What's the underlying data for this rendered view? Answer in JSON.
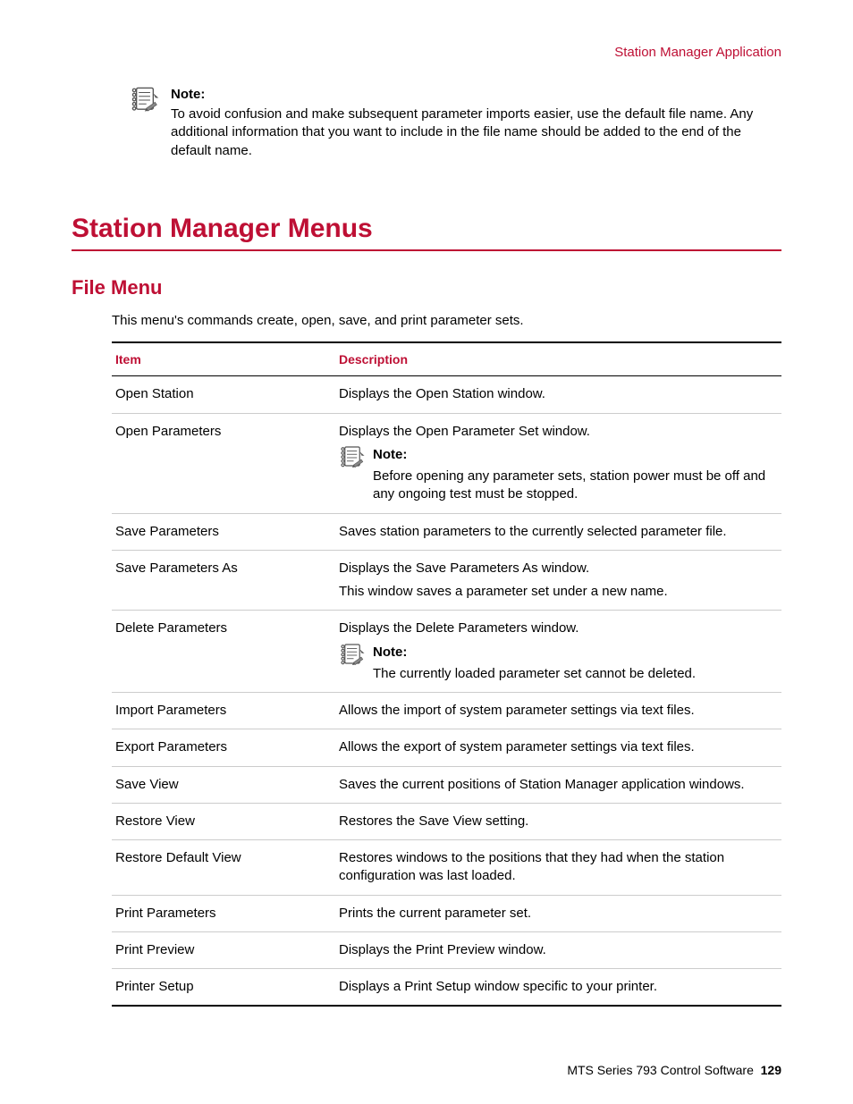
{
  "header": {
    "right": "Station Manager Application"
  },
  "topNote": {
    "label": "Note:",
    "text": "To avoid confusion and make subsequent parameter imports easier, use the default file name. Any additional information that you want to include in the file name should be added to the end of the default name."
  },
  "section": {
    "title": "Station Manager Menus"
  },
  "subsection": {
    "title": "File Menu",
    "intro": "This menu's commands create, open, save, and print parameter sets."
  },
  "table": {
    "headers": {
      "item": "Item",
      "desc": "Description"
    },
    "rows": [
      {
        "item": "Open Station",
        "desc": [
          "Displays the Open Station window."
        ]
      },
      {
        "item": "Open Parameters",
        "desc": [
          "Displays the Open Parameter Set window."
        ],
        "note": {
          "label": "Note:",
          "text": "Before opening any parameter sets, station power must be off and any ongoing test must be stopped."
        }
      },
      {
        "item": "Save Parameters",
        "desc": [
          "Saves station parameters to the currently selected parameter file."
        ]
      },
      {
        "item": "Save Parameters As",
        "desc": [
          "Displays the Save Parameters As window.",
          "This window saves a parameter set under a new name."
        ]
      },
      {
        "item": "Delete Parameters",
        "desc": [
          "Displays the Delete Parameters window."
        ],
        "note": {
          "label": "Note:",
          "text": "The currently loaded parameter set cannot be deleted."
        }
      },
      {
        "item": "Import Parameters",
        "desc": [
          "Allows the import of system parameter settings via text files."
        ]
      },
      {
        "item": "Export Parameters",
        "desc": [
          "Allows the export of system parameter settings via text files."
        ]
      },
      {
        "item": "Save View",
        "desc": [
          "Saves the current positions of Station Manager application windows."
        ]
      },
      {
        "item": "Restore View",
        "desc": [
          "Restores the Save View setting."
        ]
      },
      {
        "item": "Restore Default View",
        "desc": [
          "Restores windows to the positions that they had when the station configuration was last loaded."
        ]
      },
      {
        "item": "Print Parameters",
        "desc": [
          "Prints the current parameter set."
        ]
      },
      {
        "item": "Print Preview",
        "desc": [
          "Displays the Print Preview window."
        ]
      },
      {
        "item": "Printer Setup",
        "desc": [
          "Displays a Print Setup window specific to your printer."
        ]
      }
    ]
  },
  "footer": {
    "text": "MTS Series 793 Control Software",
    "page": "129"
  }
}
